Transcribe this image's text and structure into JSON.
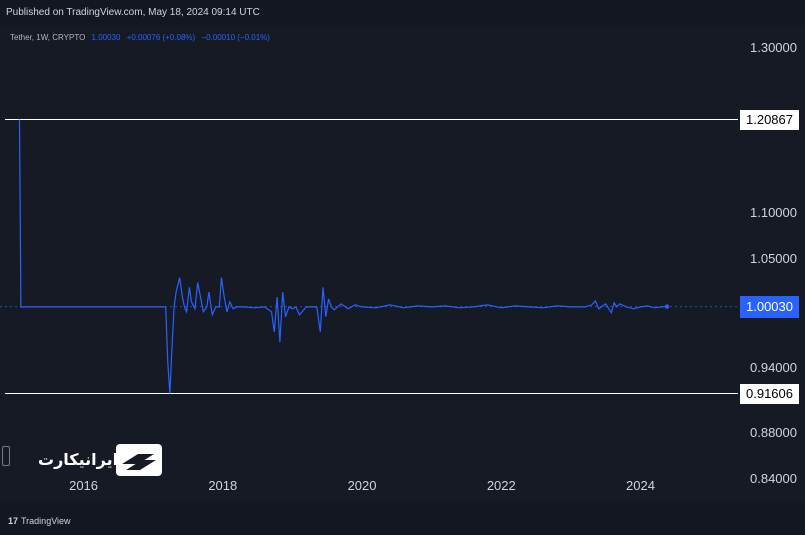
{
  "header": {
    "published": "Published on TradingView.com, May 18, 2024 09:14 UTC"
  },
  "legend": {
    "symbol": "Tether, 1W, CRYPTO",
    "last": "1.00030",
    "change": "+0.00076 (+0.08%)",
    "change2": "−0.00010 (−0.01%)"
  },
  "footer": {
    "brand_logo": "17",
    "brand": "TradingView"
  },
  "watermark": {
    "text": "ایرانیکارت",
    "icon": "card-icon"
  },
  "colors": {
    "line": "#2962ff",
    "background": "#161a25",
    "hline": "#ffffff",
    "text": "#d1d4dc"
  },
  "chart_data": {
    "type": "line",
    "title": "",
    "xlabel": "",
    "ylabel": "",
    "yscale": "log",
    "ylim": [
      0.82,
      1.33
    ],
    "xlim": [
      2014.8,
      2025.4
    ],
    "ytick_labels": [
      "1.30000",
      "1.10000",
      "1.05000",
      "0.94000",
      "0.88000",
      "0.84000"
    ],
    "ytick_values": [
      1.3,
      1.1,
      1.05,
      0.94,
      0.88,
      0.84
    ],
    "xtick_labels": [
      "2016",
      "2018",
      "2020",
      "2022",
      "2024"
    ],
    "xtick_values": [
      2016,
      2018,
      2020,
      2022,
      2024
    ],
    "horizontal_lines": [
      {
        "label": "1.20867",
        "value": 1.20867
      },
      {
        "label": "0.91606",
        "value": 0.91606
      }
    ],
    "last_value": {
      "label": "1.00030",
      "value": 1.0003
    },
    "series": [
      {
        "x": [
          2015.08,
          2015.1,
          2015.5,
          2016.0,
          2016.5,
          2017.0,
          2017.1,
          2017.18,
          2017.21,
          2017.24,
          2017.27,
          2017.3,
          2017.33,
          2017.38,
          2017.42,
          2017.45,
          2017.48,
          2017.52,
          2017.55,
          2017.6,
          2017.64,
          2017.68,
          2017.72,
          2017.77,
          2017.8,
          2017.85,
          2017.9,
          2017.95,
          2017.98,
          2018.02,
          2018.06,
          2018.1,
          2018.15,
          2018.2,
          2018.3,
          2018.45,
          2018.6,
          2018.7,
          2018.74,
          2018.78,
          2018.82,
          2018.86,
          2018.9,
          2018.95,
          2019.0,
          2019.05,
          2019.1,
          2019.2,
          2019.35,
          2019.4,
          2019.44,
          2019.48,
          2019.52,
          2019.56,
          2019.6,
          2019.7,
          2019.8,
          2019.9,
          2020.0,
          2020.2,
          2020.4,
          2020.6,
          2020.8,
          2021.0,
          2021.2,
          2021.4,
          2021.6,
          2021.8,
          2022.0,
          2022.2,
          2022.4,
          2022.6,
          2022.8,
          2023.0,
          2023.2,
          2023.3,
          2023.35,
          2023.4,
          2023.5,
          2023.58,
          2023.62,
          2023.66,
          2023.7,
          2023.8,
          2023.9,
          2024.0,
          2024.1,
          2024.2,
          2024.3,
          2024.38
        ],
        "y": [
          1.20867,
          1.0,
          1.0,
          1.0,
          1.0,
          1.0,
          1.0,
          1.0,
          0.945,
          0.91606,
          0.96,
          1.0,
          1.015,
          1.03,
          1.01,
          1.0,
          0.995,
          1.02,
          1.005,
          0.998,
          1.025,
          1.01,
          0.995,
          1.0,
          1.015,
          0.992,
          1.0,
          1.0,
          1.03,
          1.01,
          0.995,
          1.005,
          0.998,
          1.0,
          1.0,
          0.999,
          1.0,
          0.995,
          0.975,
          1.01,
          0.965,
          1.015,
          0.99,
          1.0,
          0.998,
          1.0,
          0.992,
          1.0,
          1.0,
          0.975,
          1.02,
          0.99,
          1.008,
          1.0,
          0.997,
          1.003,
          0.998,
          1.002,
          1.0,
          0.999,
          1.002,
          0.999,
          1.001,
          1.0,
          1.001,
          0.999,
          1.0,
          1.002,
          0.999,
          1.001,
          1.0,
          0.999,
          1.001,
          1.0,
          1.0,
          1.002,
          1.006,
          0.998,
          1.003,
          0.994,
          1.004,
          1.0,
          1.003,
          1.0,
          0.998,
          1.0,
          1.001,
          0.999,
          1.0,
          1.0003
        ]
      }
    ]
  }
}
